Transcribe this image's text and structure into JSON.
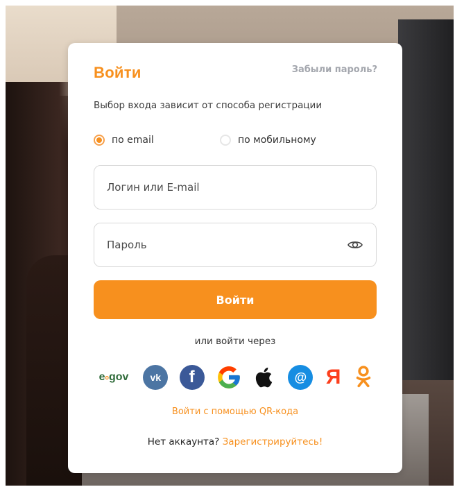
{
  "login": {
    "title": "Войти",
    "forgot_link": "Забыли пароль?",
    "subtitle": "Выбор входа зависит от способа регистрации",
    "method_options": [
      {
        "label": "по email",
        "selected": true
      },
      {
        "label": "по мобильному",
        "selected": false
      }
    ],
    "login_field": {
      "placeholder": "Логин или E-mail",
      "value": ""
    },
    "password_field": {
      "placeholder": "Пароль",
      "value": ""
    },
    "submit_label": "Войти",
    "or_text": "или войти через",
    "socials": [
      {
        "name": "egov",
        "icon": "egov-logo"
      },
      {
        "name": "vk",
        "icon": "vk-icon",
        "label": "vk"
      },
      {
        "name": "facebook",
        "icon": "facebook-icon",
        "label": "f"
      },
      {
        "name": "google",
        "icon": "google-icon"
      },
      {
        "name": "apple",
        "icon": "apple-icon"
      },
      {
        "name": "mail.ru",
        "icon": "mail-ru-icon",
        "label": "@"
      },
      {
        "name": "yandex",
        "icon": "yandex-icon",
        "label": "Я"
      },
      {
        "name": "odnoklassniki",
        "icon": "ok-icon"
      }
    ],
    "qr_link": "Войти с помощью QR-кода",
    "no_account_text": "Нет аккаунта?",
    "register_link": "Зарегистрируйтесь!"
  },
  "colors": {
    "accent": "#f7901e",
    "muted": "#a4a7ae",
    "vk": "#4c75a3",
    "facebook": "#3b5998",
    "mail": "#168de2",
    "yandex": "#fc3f1d"
  }
}
